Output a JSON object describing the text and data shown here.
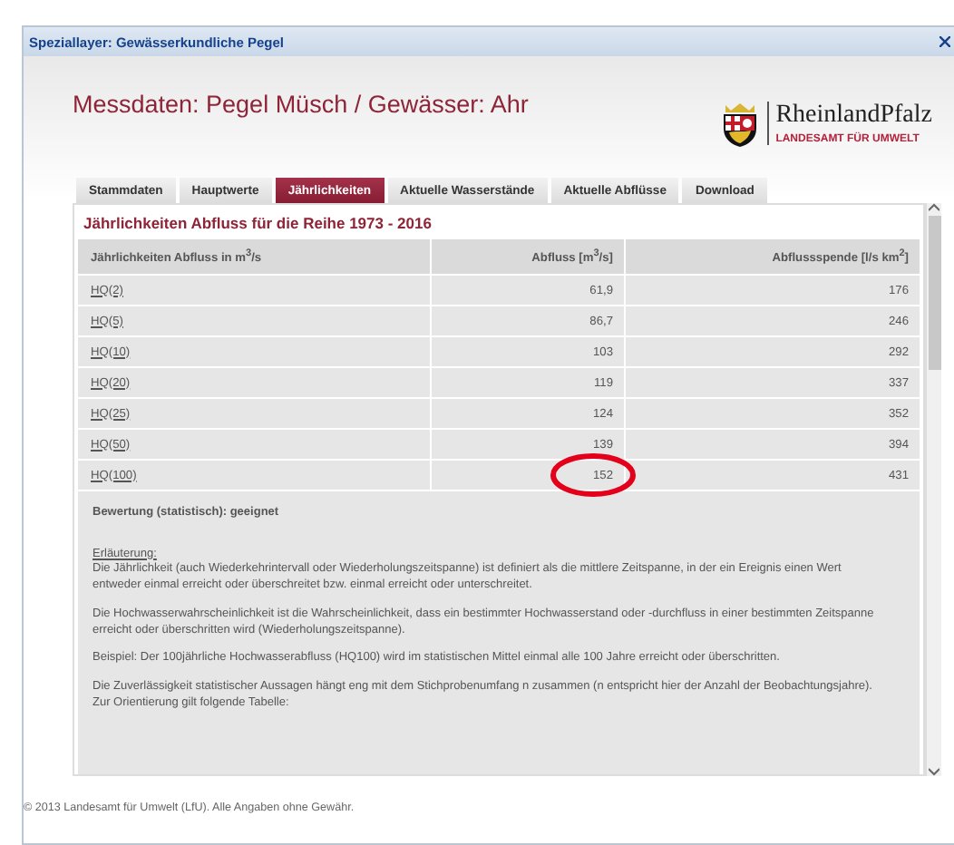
{
  "window": {
    "title": "Speziallayer: Gewässerkundliche Pegel"
  },
  "header": {
    "title": "Messdaten: Pegel Müsch / Gewässer: Ahr",
    "logo_name": "RheinlandPfalz",
    "logo_subtitle": "LANDESAMT FÜR UMWELT"
  },
  "tabs": [
    {
      "label": "Stammdaten",
      "selected": false
    },
    {
      "label": "Hauptwerte",
      "selected": false
    },
    {
      "label": "Jährlichkeiten",
      "selected": true
    },
    {
      "label": "Aktuelle Wasserstände",
      "selected": false
    },
    {
      "label": "Aktuelle Abflüsse",
      "selected": false
    },
    {
      "label": "Download",
      "selected": false
    }
  ],
  "panel": {
    "heading": "Jährlichkeiten Abfluss für die Reihe 1973 - 2016",
    "table": {
      "columns": [
        "Jährlichkeiten Abfluss in m$^{3}$/s",
        "Abfluss [m$^{3}$/s]",
        "Abflussspende [l/s km$^{2}$]"
      ],
      "rows": [
        {
          "label": "HQ(2)",
          "abfluss": "61,9",
          "spende": "176",
          "circled": false
        },
        {
          "label": "HQ(5)",
          "abfluss": "86,7",
          "spende": "246",
          "circled": false
        },
        {
          "label": "HQ(10)",
          "abfluss": "103",
          "spende": "292",
          "circled": false
        },
        {
          "label": "HQ(20)",
          "abfluss": "119",
          "spende": "337",
          "circled": false
        },
        {
          "label": "HQ(25)",
          "abfluss": "124",
          "spende": "352",
          "circled": false
        },
        {
          "label": "HQ(50)",
          "abfluss": "139",
          "spende": "394",
          "circled": false
        },
        {
          "label": "HQ(100)",
          "abfluss": "152",
          "spende": "431",
          "circled": true
        }
      ]
    },
    "rating": "Bewertung (statistisch): geeignet",
    "explanation_title": "Erläuterung:",
    "paragraphs": [
      "Die Jährlichkeit (auch Wiederkehrintervall oder Wiederholungszeitspanne) ist definiert als die mittlere Zeitspanne, in der ein Ereignis einen Wert entweder einmal erreicht oder überschreitet bzw. einmal erreicht oder unterschreitet.",
      "Die Hochwasserwahrscheinlichkeit ist die Wahrscheinlichkeit, dass ein bestimmter Hochwasserstand oder -durchfluss in einer bestimmten Zeitspanne erreicht oder überschritten wird (Wiederholungszeitspanne).",
      "Beispiel: Der 100jährliche Hochwasserabfluss (HQ100) wird im statistischen Mittel einmal alle 100 Jahre erreicht oder überschritten.",
      "Die Zuverlässigkeit statistischer Aussagen hängt eng mit dem Stichprobenumfang n zusammen (n entspricht hier der Anzahl der Beobachtungsjahre). Zur Orientierung gilt folgende Tabelle:"
    ]
  },
  "footer": "© 2013 Landesamt für Umwelt (LfU). Alle Angaben ohne Gewähr."
}
